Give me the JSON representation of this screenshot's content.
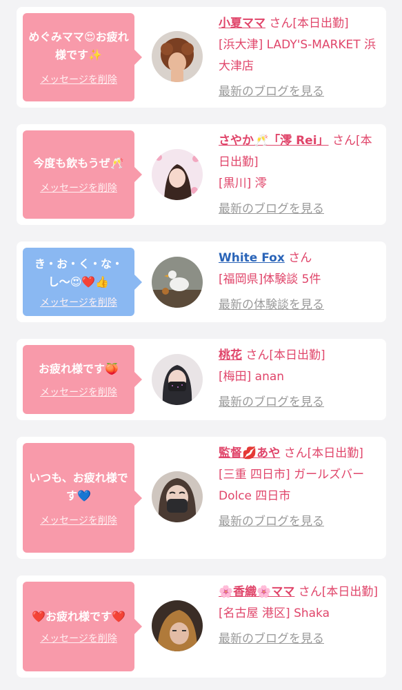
{
  "cards": [
    {
      "message": "めぐみママ😍お疲れ様です✨",
      "delete_label": "メッセージを削除",
      "name": "小夏ママ",
      "suffix": "さん[本日出勤]",
      "place": "[浜大津] LADY'S-MARKET 浜大津店",
      "link": "最新のブログを見る"
    },
    {
      "message": "今度も飲もうぜ🥂",
      "delete_label": "メッセージを削除",
      "name": "さやか🥂「澪 Rei」",
      "suffix": "さん[本日出勤]",
      "place": "[黒川] 澪",
      "link": "最新のブログを見る"
    },
    {
      "message": "き・お・く・な・し〜😍❤️👍",
      "delete_label": "メッセージを削除",
      "name": "White Fox",
      "suffix": "さん",
      "place": "[福岡県]体験談 5件",
      "link": "最新の体験談を見る"
    },
    {
      "message": "お疲れ様です🍑",
      "delete_label": "メッセージを削除",
      "name": "桃花",
      "suffix": "さん[本日出勤]",
      "place": "[梅田] anan",
      "link": "最新のブログを見る"
    },
    {
      "message": "いつも、お疲れ様です💙",
      "delete_label": "メッセージを削除",
      "name": "監督💋あや",
      "suffix": "さん[本日出勤]",
      "place": "[三重 四日市] ガールズバー Dolce 四日市",
      "link": "最新のブログを見る"
    },
    {
      "message": "❤️お疲れ様です❤️",
      "delete_label": "メッセージを削除",
      "name": "🌸香織🌸ママ",
      "suffix": "さん[本日出勤]",
      "place": "[名古屋 港区] Shaka",
      "link": "最新のブログを見る"
    }
  ],
  "colors": {
    "pink_bubble": "#f89aaa",
    "blue_bubble": "#8ab8f2",
    "name_pink": "#e0456a",
    "name_blue": "#2a64b8",
    "link_gray": "#9a9a9a"
  }
}
